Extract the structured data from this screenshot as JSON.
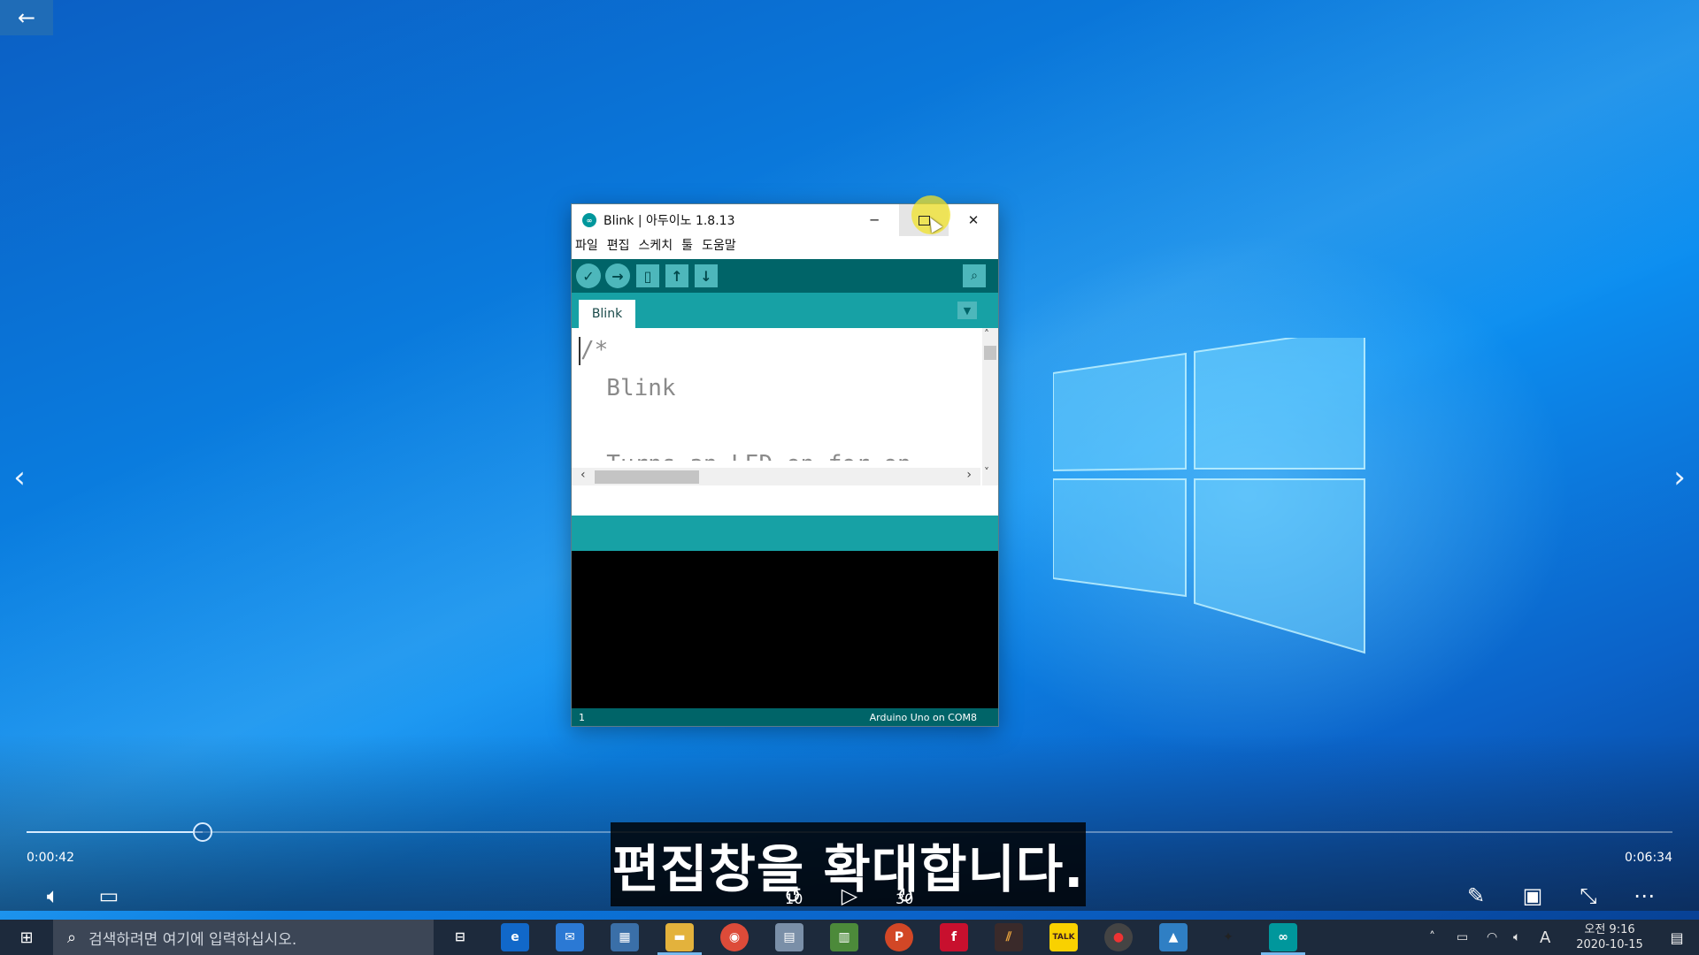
{
  "viewer": {
    "back_icon": "←",
    "prev_icon": "‹",
    "next_icon": "›"
  },
  "arduino": {
    "title": "Blink | 아두이노 1.8.13",
    "menu": [
      "파일",
      "편집",
      "스케치",
      "툴",
      "도움말"
    ],
    "tab_label": "Blink",
    "code_lines": [
      "/*",
      "  Blink",
      "",
      "  Turns an LED on for on"
    ],
    "line_number": "1",
    "board": "Arduino Uno on COM8",
    "colors": {
      "toolbar": "#006468",
      "tabbar": "#17a1a5",
      "button": "#4db7bb"
    }
  },
  "player": {
    "time_current": "0:00:42",
    "time_total": "0:06:34",
    "progress": 0.107,
    "subtitle": "편집창을 확대합니다.",
    "skip_back": "10",
    "skip_forward": "30"
  },
  "taskbar": {
    "search_placeholder": "검색하려면 여기에 입력하십시오.",
    "time": "오전 9:16",
    "date": "2020-10-15",
    "ime": "A"
  }
}
